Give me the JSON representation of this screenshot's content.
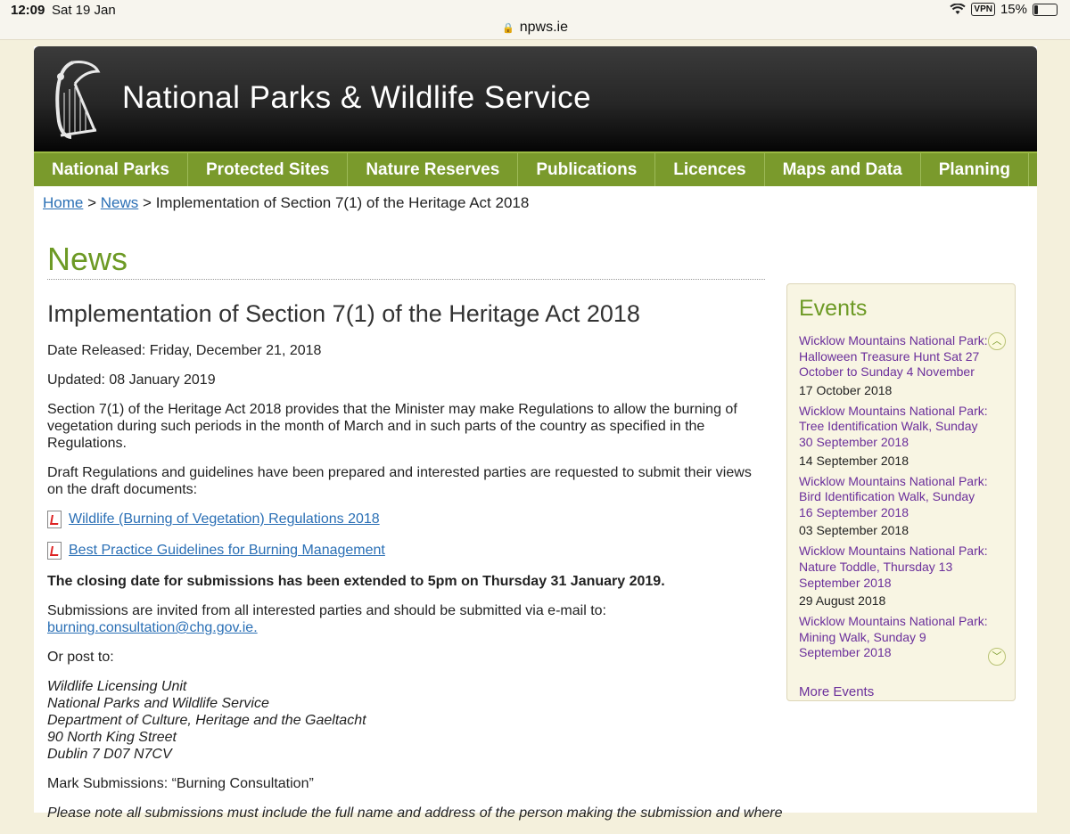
{
  "status": {
    "time": "12:09",
    "date": "Sat 19 Jan",
    "vpn": "VPN",
    "battery": "15%"
  },
  "url": "npws.ie",
  "site_title": "National Parks & Wildlife Service",
  "nav": [
    "National Parks",
    "Protected Sites",
    "Nature Reserves",
    "Publications",
    "Licences",
    "Maps and Data",
    "Planning"
  ],
  "breadcrumb": {
    "home": "Home",
    "sep1": ">",
    "news": "News",
    "sep2": ">",
    "current": "Implementation of Section 7(1) of the Heritage Act 2018"
  },
  "section_title": "News",
  "article": {
    "title": "Implementation of Section 7(1) of the Heritage Act 2018",
    "released": "Date Released: Friday, December 21, 2018",
    "updated": "Updated: 08 January 2019",
    "para1": "Section 7(1) of the Heritage Act 2018 provides that the Minister may make Regulations to allow the burning of vegetation during such periods in the month of March and in such parts of the country as specified in the Regulations.",
    "para2": "Draft Regulations and guidelines have been prepared and interested parties are requested to submit their views on the draft documents:",
    "doc1": "Wildlife (Burning of Vegetation) Regulations 2018",
    "doc2": "Best Practice Guidelines for Burning Management",
    "closing": "The closing date for submissions has been extended to 5pm on Thursday 31 January 2019.",
    "submissions": "Submissions are invited from all interested parties and should be submitted via e-mail to:",
    "email": "burning.consultation@chg.gov.ie.",
    "or_post": "Or post to:",
    "address": [
      "Wildlife Licensing Unit",
      "National Parks and Wildlife Service",
      "Department of Culture, Heritage and the Gaeltacht",
      "90 North King Street",
      "Dublin 7 D07 N7CV"
    ],
    "mark": "Mark Submissions: “Burning Consultation”",
    "note": "Please note all submissions must include the full name and address of the person making the submission and where"
  },
  "events": {
    "title": "Events",
    "items": [
      {
        "title": "Wicklow Mountains National Park: Halloween Treasure Hunt Sat 27 October to Sunday 4 November",
        "date": "17 October 2018"
      },
      {
        "title": "Wicklow Mountains National Park: Tree Identification Walk, Sunday 30 September 2018",
        "date": "14 September 2018"
      },
      {
        "title": "Wicklow Mountains National Park: Bird Identification Walk, Sunday 16 September 2018",
        "date": "03 September 2018"
      },
      {
        "title": "Wicklow Mountains National Park: Nature Toddle, Thursday 13 September 2018",
        "date": "29 August 2018"
      },
      {
        "title": "Wicklow Mountains National Park: Mining Walk, Sunday 9 September 2018",
        "date": ""
      }
    ],
    "more": "More Events"
  }
}
